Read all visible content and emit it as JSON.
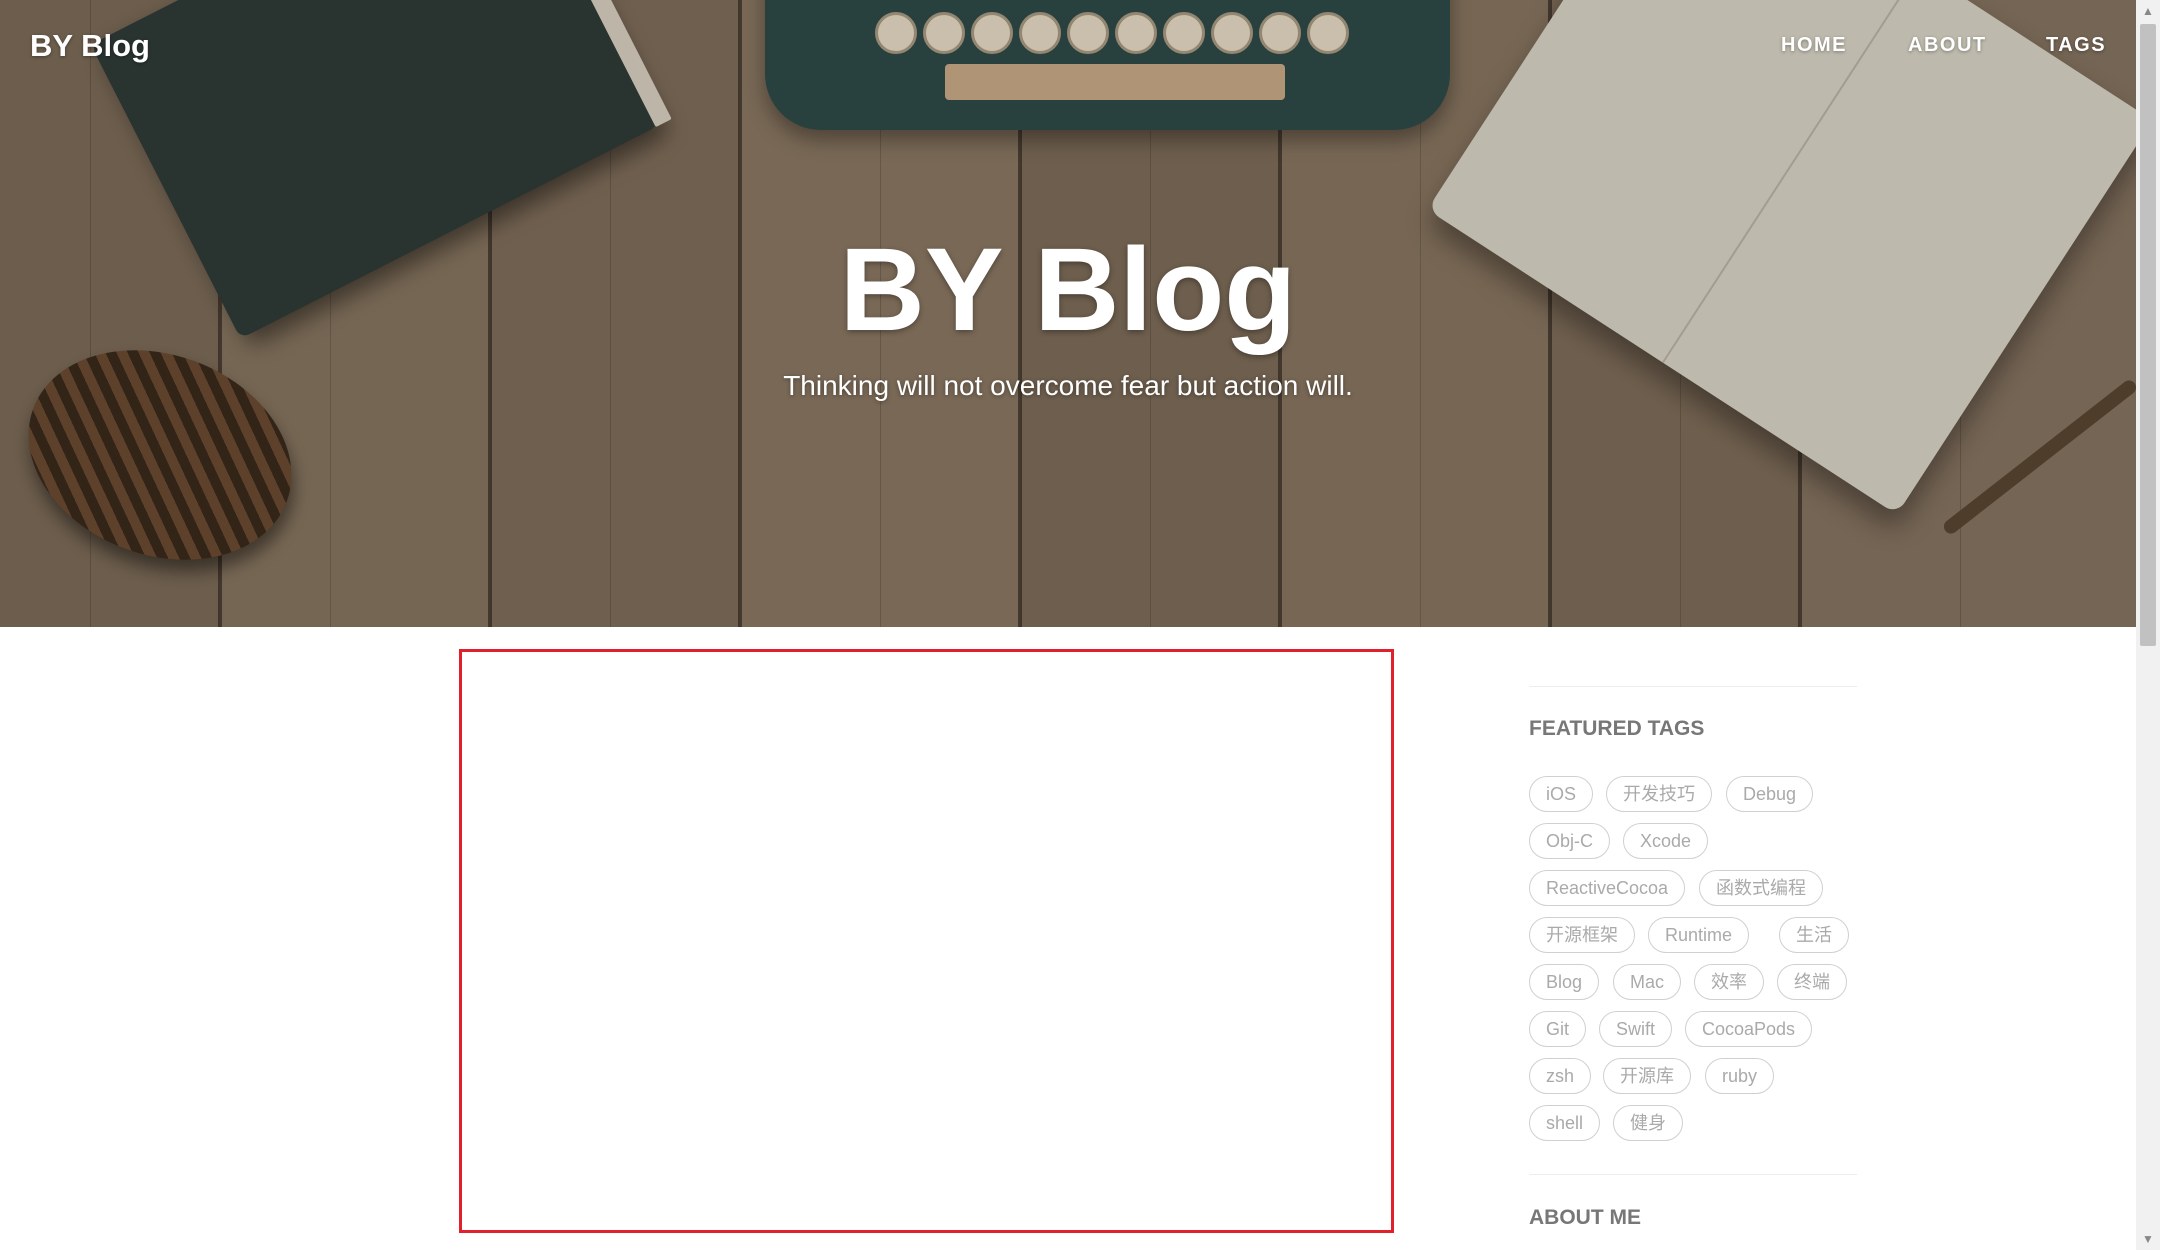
{
  "navbar": {
    "brand": "BY Blog",
    "links": [
      "HOME",
      "ABOUT",
      "TAGS"
    ]
  },
  "hero": {
    "title": "BY Blog",
    "subtitle": "Thinking will not overcome fear but action will."
  },
  "sidebar": {
    "featured_tags_heading": "FEATURED TAGS",
    "tags": [
      "iOS",
      "开发技巧",
      "Debug",
      "Obj-C",
      "Xcode",
      "ReactiveCocoa",
      "函数式编程",
      "开源框架",
      "Runtime",
      "生活",
      "Blog",
      "Mac",
      "效率",
      "终端",
      "Git",
      "Swift",
      "CocoaPods",
      "zsh",
      "开源库",
      "ruby",
      "shell",
      "健身"
    ],
    "about_heading": "ABOUT ME"
  },
  "colors": {
    "placeholder_border": "#e0202a",
    "heading_gray": "#777777",
    "tag_text": "#aaaaaa",
    "tag_border": "#d0d0d0"
  }
}
